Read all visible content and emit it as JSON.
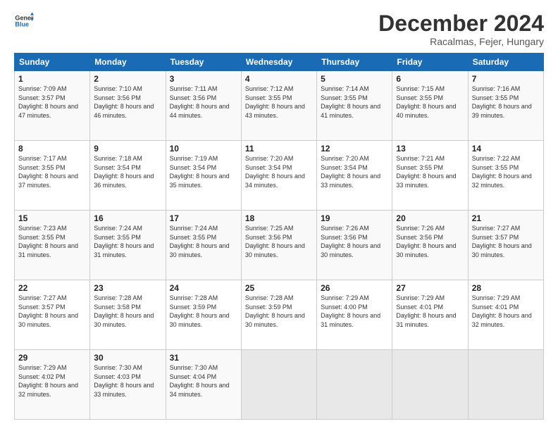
{
  "logo": {
    "line1": "General",
    "line2": "Blue"
  },
  "header": {
    "month": "December 2024",
    "location": "Racalmas, Fejer, Hungary"
  },
  "days_of_week": [
    "Sunday",
    "Monday",
    "Tuesday",
    "Wednesday",
    "Thursday",
    "Friday",
    "Saturday"
  ],
  "weeks": [
    [
      {
        "day": "1",
        "sunrise": "7:09 AM",
        "sunset": "3:57 PM",
        "daylight": "8 hours and 47 minutes."
      },
      {
        "day": "2",
        "sunrise": "7:10 AM",
        "sunset": "3:56 PM",
        "daylight": "8 hours and 46 minutes."
      },
      {
        "day": "3",
        "sunrise": "7:11 AM",
        "sunset": "3:56 PM",
        "daylight": "8 hours and 44 minutes."
      },
      {
        "day": "4",
        "sunrise": "7:12 AM",
        "sunset": "3:55 PM",
        "daylight": "8 hours and 43 minutes."
      },
      {
        "day": "5",
        "sunrise": "7:14 AM",
        "sunset": "3:55 PM",
        "daylight": "8 hours and 41 minutes."
      },
      {
        "day": "6",
        "sunrise": "7:15 AM",
        "sunset": "3:55 PM",
        "daylight": "8 hours and 40 minutes."
      },
      {
        "day": "7",
        "sunrise": "7:16 AM",
        "sunset": "3:55 PM",
        "daylight": "8 hours and 39 minutes."
      }
    ],
    [
      {
        "day": "8",
        "sunrise": "7:17 AM",
        "sunset": "3:55 PM",
        "daylight": "8 hours and 37 minutes."
      },
      {
        "day": "9",
        "sunrise": "7:18 AM",
        "sunset": "3:54 PM",
        "daylight": "8 hours and 36 minutes."
      },
      {
        "day": "10",
        "sunrise": "7:19 AM",
        "sunset": "3:54 PM",
        "daylight": "8 hours and 35 minutes."
      },
      {
        "day": "11",
        "sunrise": "7:20 AM",
        "sunset": "3:54 PM",
        "daylight": "8 hours and 34 minutes."
      },
      {
        "day": "12",
        "sunrise": "7:20 AM",
        "sunset": "3:54 PM",
        "daylight": "8 hours and 33 minutes."
      },
      {
        "day": "13",
        "sunrise": "7:21 AM",
        "sunset": "3:55 PM",
        "daylight": "8 hours and 33 minutes."
      },
      {
        "day": "14",
        "sunrise": "7:22 AM",
        "sunset": "3:55 PM",
        "daylight": "8 hours and 32 minutes."
      }
    ],
    [
      {
        "day": "15",
        "sunrise": "7:23 AM",
        "sunset": "3:55 PM",
        "daylight": "8 hours and 31 minutes."
      },
      {
        "day": "16",
        "sunrise": "7:24 AM",
        "sunset": "3:55 PM",
        "daylight": "8 hours and 31 minutes."
      },
      {
        "day": "17",
        "sunrise": "7:24 AM",
        "sunset": "3:55 PM",
        "daylight": "8 hours and 30 minutes."
      },
      {
        "day": "18",
        "sunrise": "7:25 AM",
        "sunset": "3:56 PM",
        "daylight": "8 hours and 30 minutes."
      },
      {
        "day": "19",
        "sunrise": "7:26 AM",
        "sunset": "3:56 PM",
        "daylight": "8 hours and 30 minutes."
      },
      {
        "day": "20",
        "sunrise": "7:26 AM",
        "sunset": "3:56 PM",
        "daylight": "8 hours and 30 minutes."
      },
      {
        "day": "21",
        "sunrise": "7:27 AM",
        "sunset": "3:57 PM",
        "daylight": "8 hours and 30 minutes."
      }
    ],
    [
      {
        "day": "22",
        "sunrise": "7:27 AM",
        "sunset": "3:57 PM",
        "daylight": "8 hours and 30 minutes."
      },
      {
        "day": "23",
        "sunrise": "7:28 AM",
        "sunset": "3:58 PM",
        "daylight": "8 hours and 30 minutes."
      },
      {
        "day": "24",
        "sunrise": "7:28 AM",
        "sunset": "3:59 PM",
        "daylight": "8 hours and 30 minutes."
      },
      {
        "day": "25",
        "sunrise": "7:28 AM",
        "sunset": "3:59 PM",
        "daylight": "8 hours and 30 minutes."
      },
      {
        "day": "26",
        "sunrise": "7:29 AM",
        "sunset": "4:00 PM",
        "daylight": "8 hours and 31 minutes."
      },
      {
        "day": "27",
        "sunrise": "7:29 AM",
        "sunset": "4:01 PM",
        "daylight": "8 hours and 31 minutes."
      },
      {
        "day": "28",
        "sunrise": "7:29 AM",
        "sunset": "4:01 PM",
        "daylight": "8 hours and 32 minutes."
      }
    ],
    [
      {
        "day": "29",
        "sunrise": "7:29 AM",
        "sunset": "4:02 PM",
        "daylight": "8 hours and 32 minutes."
      },
      {
        "day": "30",
        "sunrise": "7:30 AM",
        "sunset": "4:03 PM",
        "daylight": "8 hours and 33 minutes."
      },
      {
        "day": "31",
        "sunrise": "7:30 AM",
        "sunset": "4:04 PM",
        "daylight": "8 hours and 34 minutes."
      },
      null,
      null,
      null,
      null
    ]
  ],
  "labels": {
    "sunrise": "Sunrise:",
    "sunset": "Sunset:",
    "daylight": "Daylight:"
  }
}
